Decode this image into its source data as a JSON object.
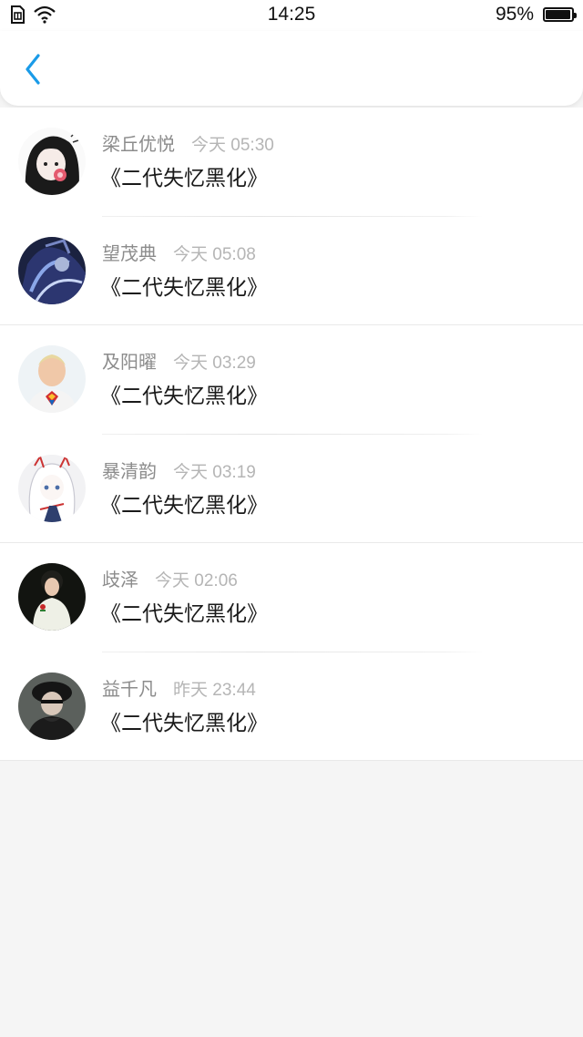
{
  "status_bar": {
    "time": "14:25",
    "battery_percent": "95%",
    "battery_level": 0.95,
    "icons": [
      "sim-card-icon",
      "wifi-icon",
      "battery-icon"
    ]
  },
  "nav": {
    "back_icon": "chevron-left-icon",
    "accent_color": "#1a9be8"
  },
  "comments": [
    {
      "name": "梁丘优悦",
      "time": "今天 05:30",
      "message": "《二代失忆黑化》",
      "avatar": "anime-girl-avatar"
    },
    {
      "name": "望茂典",
      "time": "今天 05:08",
      "message": "《二代失忆黑化》",
      "avatar": "dark-anime-avatar"
    },
    {
      "name": "及阳曜",
      "time": "今天 03:29",
      "message": "《二代失忆黑化》",
      "avatar": "child-photo-avatar"
    },
    {
      "name": "暴清韵",
      "time": "今天 03:19",
      "message": "《二代失忆黑化》",
      "avatar": "white-hair-anime-avatar"
    },
    {
      "name": "歧泽",
      "time": "今天 02:06",
      "message": "《二代失忆黑化》",
      "avatar": "woman-photo-avatar"
    },
    {
      "name": "益千凡",
      "time": "昨天 23:44",
      "message": "《二代失忆黑化》",
      "avatar": "hat-person-avatar"
    }
  ]
}
